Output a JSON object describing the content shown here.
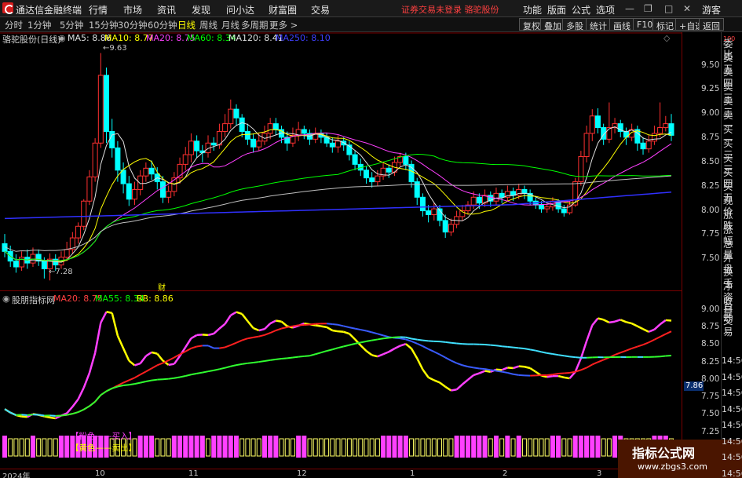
{
  "app": {
    "title": "通达信金融终端",
    "menu": [
      "行情",
      "市场",
      "资讯",
      "发现",
      "问小达",
      "财富圈",
      "交易"
    ],
    "status": "证券交易未登录 骆驼股份",
    "menu_right": [
      "功能",
      "版面",
      "公式",
      "选项"
    ],
    "user": "游客"
  },
  "toolbar": {
    "periods": [
      "分时",
      "1分钟",
      "5分钟",
      "15分钟",
      "30分钟",
      "60分钟",
      "日线",
      "周线",
      "月线",
      "多周期",
      "更多 >"
    ],
    "active_period": "日线",
    "buttons": [
      "复权",
      "叠加",
      "多股",
      "统计",
      "画线",
      "F10",
      "标记",
      "+自选",
      "返回"
    ]
  },
  "price_panel": {
    "stock_label": "骆驼股份(日线)",
    "indicators": [
      {
        "label": "MA5: 8.86",
        "color": "#e0e0e0"
      },
      {
        "label": "MA10: 8.77",
        "color": "#ffff00"
      },
      {
        "label": "MA20: 8.75",
        "color": "#ff40ff"
      },
      {
        "label": "MA60: 8.34",
        "color": "#00ff00"
      },
      {
        "label": "MA120: 8.41",
        "color": "#e0e0e0"
      },
      {
        "label": "MA250: 8.10",
        "color": "#4040ff"
      }
    ],
    "axis": [
      "9.50",
      "9.25",
      "9.00",
      "8.75",
      "8.50",
      "8.25",
      "8.00",
      "7.75",
      "7.50"
    ],
    "high_label": "9.63",
    "low_label": "7.28",
    "marker": "财"
  },
  "sub_panel": {
    "name": "股朋指标网",
    "indicators": [
      {
        "label": "MA20: 8.75",
        "color": "#ff4040"
      },
      {
        "label": "MA55: 8.34",
        "color": "#00ff00"
      },
      {
        "label": "BB: 8.86",
        "color": "#ffff00"
      }
    ],
    "axis": [
      "9.00",
      "8.75",
      "8.50",
      "8.25",
      "8.00",
      "7.75",
      "7.50",
      "7.25"
    ],
    "current_price": "7.86",
    "legend_buy": "【粉色——买入】",
    "legend_sell": "【黄色——卖出】"
  },
  "quote_panel": {
    "items": [
      "委比",
      "卖五",
      "卖四",
      "卖三",
      "卖二",
      "卖一",
      "买一",
      "买二",
      "买三",
      "买四",
      "买五",
      "现价",
      "涨跌",
      "涨幅",
      "总量",
      "外盘",
      "换手",
      "净资",
      "收益",
      "自动",
      "交易"
    ],
    "times": [
      "14:56",
      "14:56",
      "14:56",
      "14:56",
      "14:56",
      "14:56",
      "14:56",
      "14:56"
    ],
    "top_tiny": "100"
  },
  "date_axis": [
    "2024年",
    "10",
    "11",
    "12",
    "1",
    "2",
    "3"
  ],
  "watermark": {
    "title": "指标公式网",
    "url": "www.zbgs3.com"
  },
  "chart_data": [
    {
      "type": "candlestick",
      "title": "骆驼股份(日线)",
      "ylim": [
        7.25,
        9.7
      ],
      "y_ticks": [
        7.5,
        7.75,
        8.0,
        8.25,
        8.5,
        8.75,
        9.0,
        9.25,
        9.5
      ],
      "candles": [
        [
          7.66,
          7.58,
          7.76,
          7.52
        ],
        [
          7.58,
          7.48,
          7.64,
          7.42
        ],
        [
          7.48,
          7.42,
          7.55,
          7.36
        ],
        [
          7.42,
          7.52,
          7.58,
          7.38
        ],
        [
          7.52,
          7.46,
          7.6,
          7.4
        ],
        [
          7.46,
          7.55,
          7.62,
          7.42
        ],
        [
          7.55,
          7.48,
          7.6,
          7.43
        ],
        [
          7.48,
          7.4,
          7.52,
          7.3
        ],
        [
          7.4,
          7.5,
          7.56,
          7.28
        ],
        [
          7.5,
          7.44,
          7.55,
          7.38
        ],
        [
          7.44,
          7.52,
          7.58,
          7.4
        ],
        [
          7.52,
          7.6,
          7.68,
          7.48
        ],
        [
          7.6,
          7.72,
          7.78,
          7.56
        ],
        [
          7.72,
          7.84,
          7.88,
          7.66
        ],
        [
          7.84,
          8.1,
          8.12,
          7.8
        ],
        [
          8.1,
          8.35,
          8.42,
          8.06
        ],
        [
          8.35,
          8.7,
          8.75,
          8.3
        ],
        [
          8.7,
          9.4,
          9.63,
          8.65
        ],
        [
          9.4,
          8.82,
          9.48,
          8.7
        ],
        [
          8.82,
          8.65,
          8.95,
          8.55
        ],
        [
          8.65,
          8.42,
          8.72,
          8.3
        ],
        [
          8.42,
          8.28,
          8.5,
          8.18
        ],
        [
          8.28,
          8.12,
          8.36,
          8.05
        ],
        [
          8.12,
          8.22,
          8.3,
          8.06
        ],
        [
          8.22,
          8.36,
          8.42,
          8.16
        ],
        [
          8.36,
          8.44,
          8.5,
          8.3
        ],
        [
          8.44,
          8.38,
          8.52,
          8.32
        ],
        [
          8.38,
          8.3,
          8.45,
          8.22
        ],
        [
          8.3,
          8.14,
          8.36,
          8.08
        ],
        [
          8.14,
          8.2,
          8.26,
          8.08
        ],
        [
          8.2,
          8.34,
          8.4,
          8.15
        ],
        [
          8.34,
          8.48,
          8.55,
          8.28
        ],
        [
          8.48,
          8.58,
          8.66,
          8.42
        ],
        [
          8.58,
          8.72,
          8.8,
          8.5
        ],
        [
          8.72,
          8.62,
          8.78,
          8.55
        ],
        [
          8.62,
          8.6,
          8.68,
          8.5
        ],
        [
          8.6,
          8.7,
          8.78,
          8.55
        ],
        [
          8.7,
          8.68,
          8.76,
          8.62
        ],
        [
          8.68,
          8.82,
          8.9,
          8.64
        ],
        [
          8.82,
          8.9,
          9.0,
          8.76
        ],
        [
          8.9,
          9.05,
          9.15,
          8.85
        ],
        [
          9.05,
          8.96,
          9.1,
          8.88
        ],
        [
          8.96,
          8.82,
          9.0,
          8.76
        ],
        [
          8.82,
          8.74,
          8.9,
          8.68
        ],
        [
          8.74,
          8.66,
          8.8,
          8.6
        ],
        [
          8.66,
          8.72,
          8.8,
          8.62
        ],
        [
          8.72,
          8.8,
          8.88,
          8.68
        ],
        [
          8.8,
          8.9,
          8.96,
          8.74
        ],
        [
          8.9,
          8.84,
          8.96,
          8.78
        ],
        [
          8.84,
          8.76,
          8.88,
          8.7
        ],
        [
          8.76,
          8.7,
          8.82,
          8.62
        ],
        [
          8.7,
          8.78,
          8.86,
          8.66
        ],
        [
          8.78,
          8.84,
          8.92,
          8.72
        ],
        [
          8.84,
          8.8,
          8.88,
          8.74
        ],
        [
          8.8,
          8.74,
          8.84,
          8.68
        ],
        [
          8.74,
          8.8,
          8.86,
          8.7
        ],
        [
          8.8,
          8.76,
          8.84,
          8.7
        ],
        [
          8.76,
          8.7,
          8.8,
          8.66
        ],
        [
          8.7,
          8.66,
          8.76,
          8.6
        ],
        [
          8.66,
          8.72,
          8.78,
          8.6
        ],
        [
          8.72,
          8.68,
          8.76,
          8.62
        ],
        [
          8.68,
          8.58,
          8.72,
          8.52
        ],
        [
          8.58,
          8.48,
          8.62,
          8.42
        ],
        [
          8.48,
          8.42,
          8.54,
          8.36
        ],
        [
          8.42,
          8.34,
          8.46,
          8.28
        ],
        [
          8.34,
          8.3,
          8.4,
          8.24
        ],
        [
          8.3,
          8.36,
          8.42,
          8.26
        ],
        [
          8.36,
          8.44,
          8.5,
          8.32
        ],
        [
          8.44,
          8.4,
          8.48,
          8.34
        ],
        [
          8.4,
          8.5,
          8.56,
          8.36
        ],
        [
          8.5,
          8.56,
          8.6,
          8.46
        ],
        [
          8.56,
          8.48,
          8.6,
          8.42
        ],
        [
          8.48,
          8.3,
          8.52,
          8.24
        ],
        [
          8.3,
          8.14,
          8.34,
          8.06
        ],
        [
          8.14,
          8.0,
          8.18,
          7.94
        ],
        [
          8.0,
          7.96,
          8.06,
          7.88
        ],
        [
          7.96,
          8.02,
          8.08,
          7.9
        ],
        [
          8.02,
          7.9,
          8.06,
          7.84
        ],
        [
          7.9,
          7.78,
          7.96,
          7.72
        ],
        [
          7.78,
          7.86,
          7.92,
          7.74
        ],
        [
          7.86,
          7.94,
          8.0,
          7.82
        ],
        [
          7.94,
          8.0,
          8.06,
          7.9
        ],
        [
          8.0,
          8.06,
          8.1,
          7.96
        ],
        [
          8.06,
          8.14,
          8.2,
          8.02
        ],
        [
          8.14,
          8.08,
          8.18,
          8.02
        ],
        [
          8.08,
          8.16,
          8.22,
          8.04
        ],
        [
          8.16,
          8.1,
          8.2,
          8.04
        ],
        [
          8.1,
          8.18,
          8.24,
          8.06
        ],
        [
          8.18,
          8.14,
          8.22,
          8.08
        ],
        [
          8.14,
          8.2,
          8.26,
          8.1
        ],
        [
          8.2,
          8.16,
          8.24,
          8.1
        ],
        [
          8.16,
          8.22,
          8.28,
          8.12
        ],
        [
          8.22,
          8.18,
          8.26,
          8.12
        ],
        [
          8.18,
          8.1,
          8.22,
          8.06
        ],
        [
          8.1,
          8.06,
          8.14,
          8.02
        ],
        [
          8.06,
          8.02,
          8.1,
          7.98
        ],
        [
          8.02,
          8.04,
          8.08,
          7.98
        ],
        [
          8.04,
          8.1,
          8.14,
          8.0
        ],
        [
          8.1,
          8.02,
          8.12,
          7.98
        ],
        [
          8.02,
          7.98,
          8.06,
          7.94
        ],
        [
          7.98,
          8.06,
          8.1,
          7.96
        ],
        [
          8.06,
          8.3,
          8.34,
          8.04
        ],
        [
          8.3,
          8.56,
          8.62,
          8.26
        ],
        [
          8.56,
          8.8,
          8.88,
          8.5
        ],
        [
          8.8,
          8.98,
          9.05,
          8.72
        ],
        [
          8.98,
          8.86,
          9.06,
          8.8
        ],
        [
          8.86,
          8.74,
          8.9,
          8.68
        ],
        [
          8.74,
          8.86,
          9.12,
          8.7
        ],
        [
          8.86,
          8.9,
          8.96,
          8.8
        ],
        [
          8.9,
          8.82,
          8.94,
          8.76
        ],
        [
          8.82,
          8.76,
          8.86,
          8.68
        ],
        [
          8.76,
          8.84,
          8.9,
          8.72
        ],
        [
          8.84,
          8.7,
          8.88,
          8.62
        ],
        [
          8.7,
          8.64,
          8.76,
          8.58
        ],
        [
          8.64,
          8.72,
          8.78,
          8.6
        ],
        [
          8.72,
          8.8,
          8.88,
          8.68
        ],
        [
          8.8,
          8.86,
          9.12,
          8.76
        ],
        [
          8.86,
          8.9,
          8.98,
          8.82
        ],
        [
          8.9,
          8.78,
          9.0,
          8.72
        ]
      ],
      "ma5_last": 8.86,
      "ma10_last": 8.77,
      "ma20_last": 8.75,
      "ma60_last": 8.34,
      "ma120_last": 8.41,
      "ma250_last": 8.1,
      "high": 9.63,
      "low": 7.28
    },
    {
      "type": "line",
      "title": "股朋指标网",
      "ylim": [
        7.2,
        9.1
      ],
      "y_ticks": [
        7.25,
        7.5,
        7.75,
        8.0,
        8.25,
        8.5,
        8.75,
        9.0
      ],
      "series": [
        {
          "name": "MA20",
          "color": "#ff4040",
          "last": 8.75
        },
        {
          "name": "MA55",
          "color": "#00ff00",
          "last": 8.34
        },
        {
          "name": "BB",
          "color": "#ffff00",
          "last": 8.86
        }
      ]
    }
  ]
}
